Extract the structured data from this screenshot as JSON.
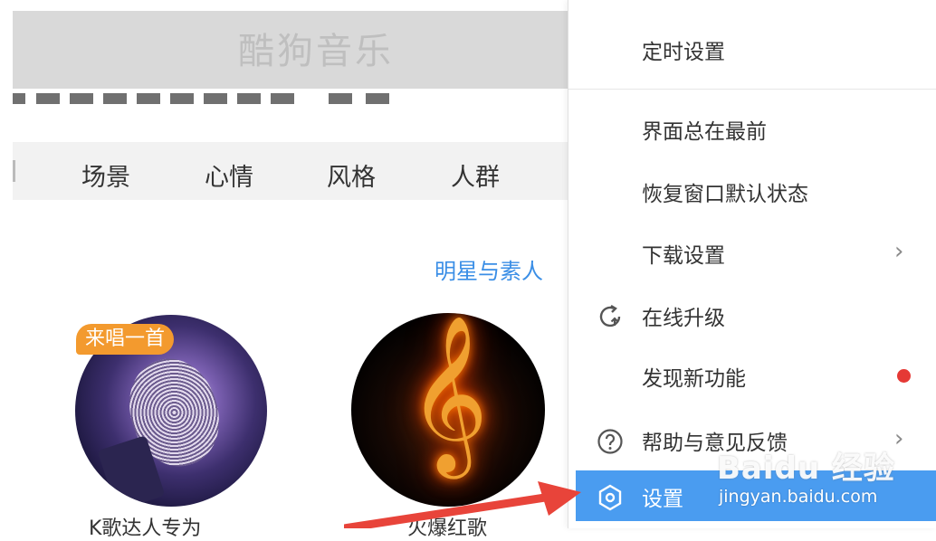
{
  "header": {
    "title": "酷狗音乐"
  },
  "nav": {
    "items": [
      "场景",
      "心情",
      "风格",
      "人群"
    ]
  },
  "section": {
    "link": "明星与素人"
  },
  "cards": {
    "badge": "来唱一首",
    "items": [
      {
        "icon": "microphone-thumbnail",
        "title": "K歌达人专为"
      },
      {
        "icon": "treble-clef-fire-thumbnail",
        "title": "火爆红歌"
      }
    ]
  },
  "menu": {
    "items": [
      {
        "label": "定时设置"
      },
      {
        "label": "界面总在最前"
      },
      {
        "label": "恢复窗口默认状态"
      },
      {
        "label": "下载设置",
        "submenu": true
      },
      {
        "label": "在线升级",
        "icon": "upgrade-icon"
      },
      {
        "label": "发现新功能",
        "new_dot": true
      },
      {
        "label": "帮助与意见反馈",
        "icon": "help-icon",
        "submenu": true
      },
      {
        "label": "设置",
        "icon": "settings-icon",
        "active": true
      }
    ],
    "chevron": "›"
  },
  "watermark": {
    "logo": "Baidu 经验",
    "url": "jingyan.baidu.com"
  },
  "colors": {
    "accent": "#4a9cf0",
    "link": "#3a8ee6",
    "badge": "#f39a2e",
    "dot": "#e53935",
    "arrow": "#e8443a"
  }
}
